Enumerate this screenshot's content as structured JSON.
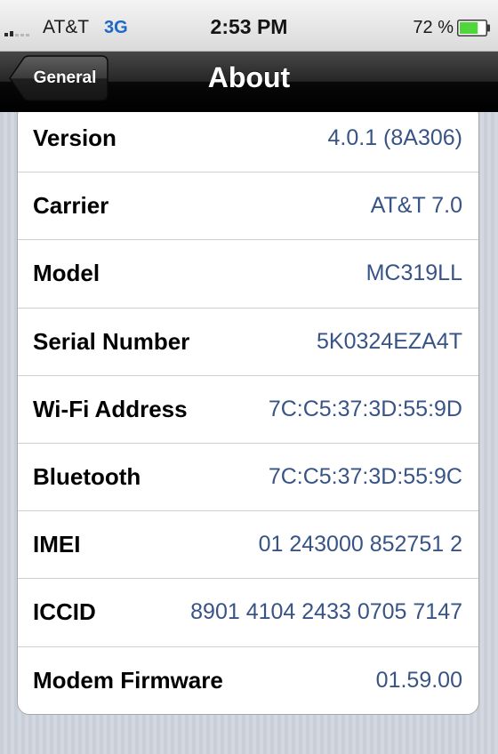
{
  "status_bar": {
    "carrier": "AT&T",
    "network": "3G",
    "time": "2:53 PM",
    "battery_percent": "72 %",
    "battery_level": 0.72,
    "signal_bars": 2,
    "icons": [
      "signal-strength-icon",
      "battery-icon"
    ]
  },
  "nav": {
    "back_label": "General",
    "title": "About"
  },
  "rows": [
    {
      "label": "Version",
      "value": "4.0.1 (8A306)"
    },
    {
      "label": "Carrier",
      "value": "AT&T 7.0"
    },
    {
      "label": "Model",
      "value": "MC319LL"
    },
    {
      "label": "Serial Number",
      "value": "5K0324EZA4T"
    },
    {
      "label": "Wi-Fi Address",
      "value": "7C:C5:37:3D:55:9D"
    },
    {
      "label": "Bluetooth",
      "value": "7C:C5:37:3D:55:9C"
    },
    {
      "label": "IMEI",
      "value": "01 243000 852751 2"
    },
    {
      "label": "ICCID",
      "value": "8901 4104 2433 0705 7147"
    },
    {
      "label": "Modem Firmware",
      "value": "01.59.00"
    }
  ],
  "colors": {
    "value_text": "#385487",
    "network_text": "#1f67c7",
    "battery_fill": "#4fd63a"
  }
}
